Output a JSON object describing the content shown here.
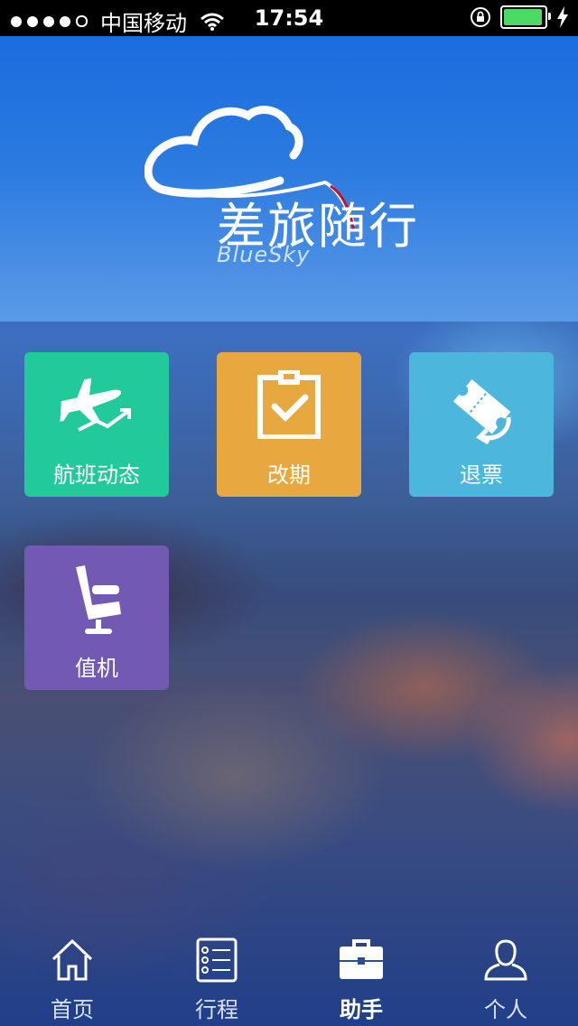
{
  "status_bar": {
    "carrier": "中国移动",
    "time": "17:54",
    "battery_level": 0.95
  },
  "logo": {
    "title": "差旅随行",
    "subtitle": "BlueSky"
  },
  "tiles": [
    {
      "label": "航班动态",
      "icon": "plane-icon",
      "color": "#22c99a"
    },
    {
      "label": "改期",
      "icon": "clipboard-check-icon",
      "color": "#e7a93f"
    },
    {
      "label": "退票",
      "icon": "ticket-return-icon",
      "color": "#4cb6dc"
    },
    {
      "label": "值机",
      "icon": "seat-icon",
      "color": "#7259b2"
    }
  ],
  "tab_bar": {
    "items": [
      {
        "label": "首页",
        "icon": "home-icon"
      },
      {
        "label": "行程",
        "icon": "itinerary-list-icon"
      },
      {
        "label": "助手",
        "icon": "briefcase-icon"
      },
      {
        "label": "个人",
        "icon": "user-icon"
      }
    ],
    "active": "助手"
  }
}
